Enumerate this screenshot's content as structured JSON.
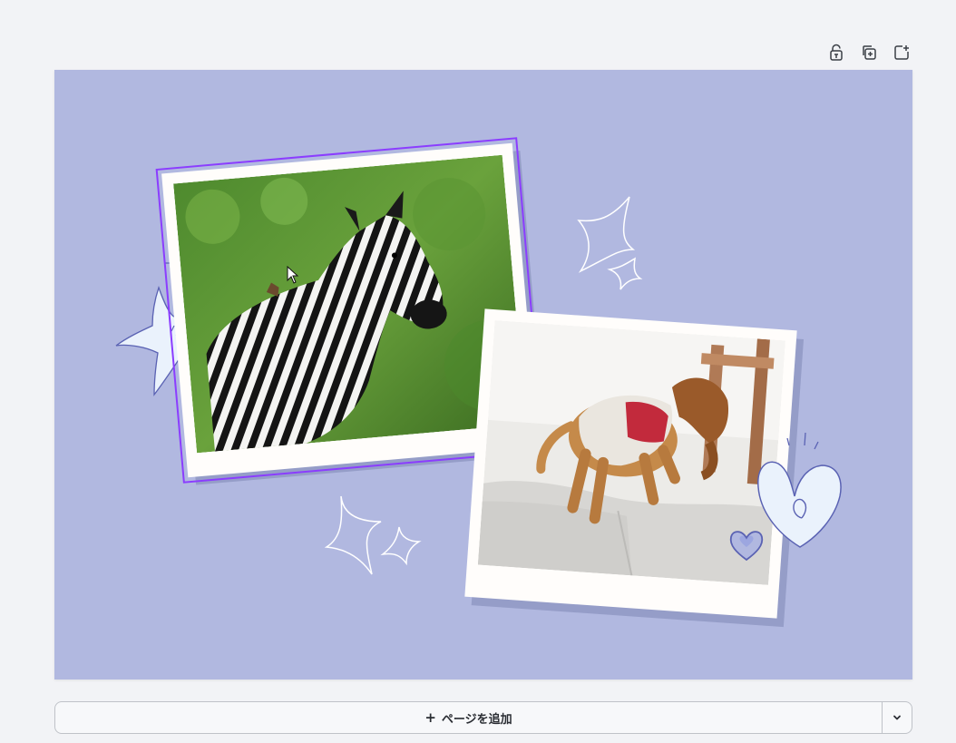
{
  "toolbar": {
    "lock_icon": "lock-icon",
    "duplicate_icon": "duplicate-page-icon",
    "add_icon": "add-page-icon"
  },
  "canvas": {
    "background_color": "#b1b8e0",
    "selection_color": "#8b3dff",
    "photos": [
      {
        "name": "zebra-photo",
        "subject": "zebra"
      },
      {
        "name": "dog-photo",
        "subject": "dog"
      }
    ]
  },
  "add_page": {
    "plus": "+",
    "label": "ページを追加",
    "dropdown_icon": "chevron-down-icon"
  }
}
